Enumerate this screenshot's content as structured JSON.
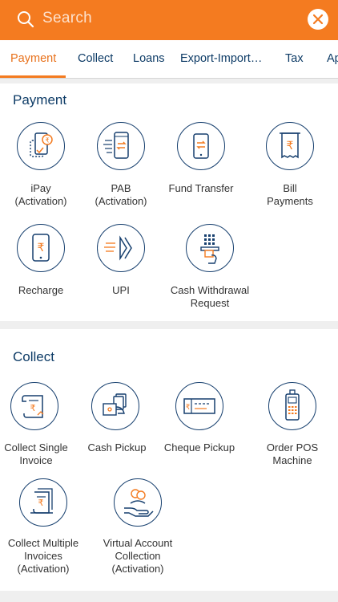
{
  "search": {
    "placeholder": "Search"
  },
  "tabs": [
    {
      "label": "Payment"
    },
    {
      "label": "Collect"
    },
    {
      "label": "Loans"
    },
    {
      "label": "Export-Import…"
    },
    {
      "label": "Tax"
    },
    {
      "label": "Ap"
    }
  ],
  "payment": {
    "title": "Payment",
    "items": [
      {
        "label": "iPay\n(Activation)",
        "icon": "ipay-icon"
      },
      {
        "label": "PAB\n(Activation)",
        "icon": "pab-icon"
      },
      {
        "label": "Fund Transfer",
        "icon": "fund-transfer-icon"
      },
      {
        "label": "Bill\nPayments",
        "icon": "bill-icon"
      },
      {
        "label": "Recharge",
        "icon": "recharge-icon"
      },
      {
        "label": "UPI",
        "icon": "upi-icon"
      },
      {
        "label": "Cash Withdrawal\nRequest",
        "icon": "atm-icon"
      }
    ]
  },
  "collect": {
    "title": "Collect",
    "items": [
      {
        "label": "Collect Single\nInvoice",
        "icon": "invoice-icon"
      },
      {
        "label": "Cash Pickup",
        "icon": "cash-pickup-icon"
      },
      {
        "label": "Cheque Pickup",
        "icon": "cheque-icon"
      },
      {
        "label": "Order POS\nMachine",
        "icon": "pos-icon"
      },
      {
        "label": "Collect Multiple\nInvoices\n(Activation)",
        "icon": "invoices-icon"
      },
      {
        "label": "Virtual Account\nCollection\n(Activation)",
        "icon": "virtual-account-icon"
      }
    ]
  },
  "colors": {
    "accent": "#f47b20",
    "navy": "#163f6e"
  }
}
